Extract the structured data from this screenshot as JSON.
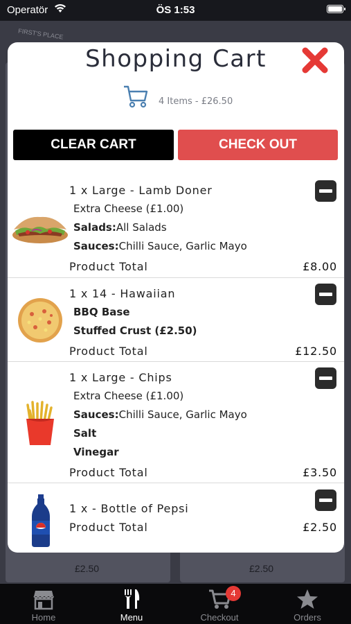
{
  "status_bar": {
    "carrier": "Operatör",
    "time": "ÖS 1:53"
  },
  "background": {
    "logo_text": "FIRST'S PLACE",
    "price_left": "£2.50",
    "price_right": "£2.50"
  },
  "modal": {
    "title": "Shopping Cart",
    "summary": "4 Items - £26.50",
    "clear_label": "CLEAR CART",
    "checkout_label": "CHECK OUT"
  },
  "items": [
    {
      "name": "1 x Large - Lamb Doner",
      "opt1": "Extra Cheese (£1.00)",
      "opt2_key": "Salads:",
      "opt2_val": "All Salads",
      "opt3_key": "Sauces:",
      "opt3_val": "Chilli Sauce, Garlic Mayo",
      "total_label": "Product Total",
      "total": "£8.00"
    },
    {
      "name": "1 x 14 - Hawaiian",
      "opt1": "BBQ Base",
      "opt2": "Stuffed Crust (£2.50)",
      "total_label": "Product Total",
      "total": "£12.50"
    },
    {
      "name": "1 x Large - Chips",
      "opt1": "Extra Cheese (£1.00)",
      "opt2_key": "Sauces:",
      "opt2_val": "Chilli Sauce, Garlic Mayo",
      "opt3": "Salt",
      "opt4": "Vinegar",
      "total_label": "Product Total",
      "total": "£3.50"
    },
    {
      "name": "1 x - Bottle of Pepsi",
      "total_label": "Product Total",
      "total": "£2.50"
    }
  ],
  "tabbar": {
    "tabs": [
      {
        "label": "Home",
        "icon": "store-icon"
      },
      {
        "label": "Menu",
        "icon": "fork-knife-icon"
      },
      {
        "label": "Checkout",
        "icon": "cart-icon",
        "badge": "4"
      },
      {
        "label": "Orders",
        "icon": "star-icon"
      }
    ],
    "active": "Menu"
  },
  "colors": {
    "accent_red": "#e04e4e",
    "close_red": "#e53935",
    "dark": "#000000"
  }
}
